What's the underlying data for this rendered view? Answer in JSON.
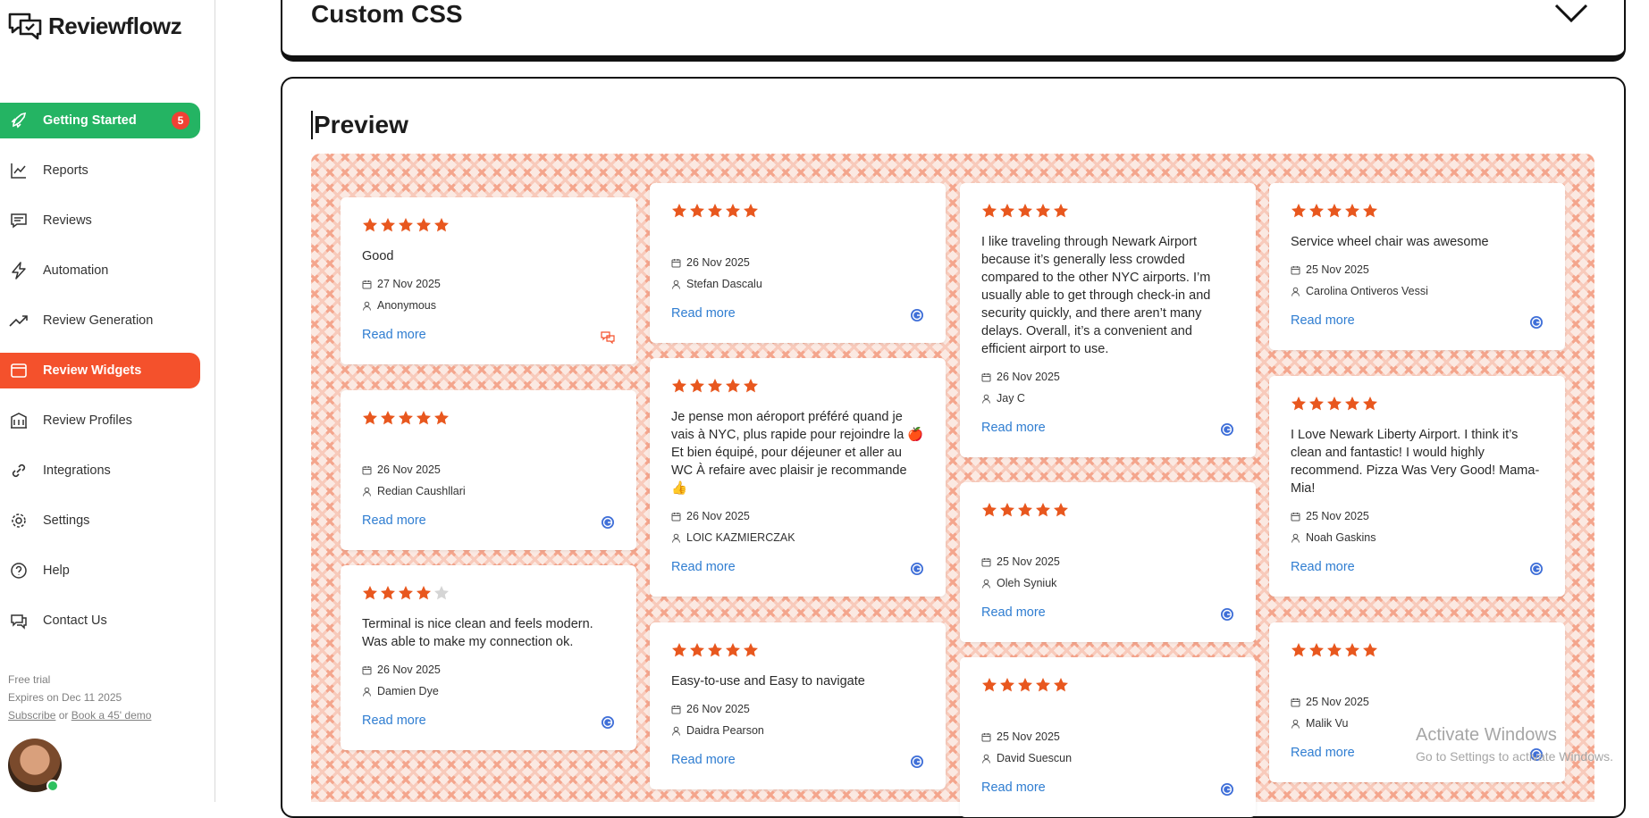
{
  "app": {
    "name": "Reviewflowz"
  },
  "sidebar": {
    "items": [
      {
        "label": "Getting Started",
        "icon": "rocket-icon",
        "badge": "5"
      },
      {
        "label": "Reports",
        "icon": "chart-icon"
      },
      {
        "label": "Reviews",
        "icon": "message-icon"
      },
      {
        "label": "Automation",
        "icon": "bolt-icon"
      },
      {
        "label": "Review Generation",
        "icon": "trend-icon"
      },
      {
        "label": "Review Widgets",
        "icon": "widget-icon"
      },
      {
        "label": "Review Profiles",
        "icon": "building-icon"
      },
      {
        "label": "Integrations",
        "icon": "link-icon"
      },
      {
        "label": "Settings",
        "icon": "gear-icon"
      },
      {
        "label": "Help",
        "icon": "help-icon"
      },
      {
        "label": "Contact Us",
        "icon": "chat-icon"
      }
    ],
    "trial": {
      "status": "Free trial",
      "expires": "Expires on Dec 11 2025",
      "subscribe": "Subscribe",
      "or": "or",
      "demo": "Book a 45' demo"
    }
  },
  "panels": {
    "custom_css_title": "Custom CSS",
    "preview_title": "Preview"
  },
  "colors": {
    "accent_green": "#24b463",
    "accent_red": "#f4512c",
    "star": "#e8571e",
    "link": "#2f7dd1"
  },
  "read_more": "Read more",
  "reviews": [
    {
      "stars": 5,
      "text": "Good",
      "date": "27 Nov 2025",
      "author": "Anonymous",
      "source": "chat-source-icon"
    },
    {
      "stars": 5,
      "text": "",
      "date": "26 Nov 2025",
      "author": "Redian Caushllari",
      "source": "google-source-icon"
    },
    {
      "stars": 4,
      "text": "Terminal is nice clean and feels modern. Was able to make my connection ok.",
      "date": "26 Nov 2025",
      "author": "Damien Dye",
      "source": "google-source-icon"
    },
    {
      "stars": 5,
      "text": "",
      "date": "26 Nov 2025",
      "author": "Stefan Dascalu",
      "source": "google-source-icon"
    },
    {
      "stars": 5,
      "text": "Je pense mon aéroport préféré quand je vais à NYC, plus rapide pour rejoindre la 🍎 Et bien équipé, pour déjeuner et aller au WC À refaire avec plaisir je recommande 👍",
      "date": "26 Nov 2025",
      "author": "LOIC KAZMIERCZAK",
      "source": "google-source-icon"
    },
    {
      "stars": 5,
      "text": "Easy-to-use and Easy to navigate",
      "date": "26 Nov 2025",
      "author": "Daidra Pearson",
      "source": "google-source-icon"
    },
    {
      "stars": 5,
      "text": "I like traveling through Newark Airport because it’s generally less crowded compared to the other NYC airports. I’m usually able to get through check-in and security quickly, and there aren’t many delays. Overall, it’s a convenient and efficient airport to use.",
      "date": "26 Nov 2025",
      "author": "Jay C",
      "source": "google-source-icon"
    },
    {
      "stars": 5,
      "text": "",
      "date": "25 Nov 2025",
      "author": "Oleh Syniuk",
      "source": "google-source-icon"
    },
    {
      "stars": 5,
      "text": "",
      "date": "25 Nov 2025",
      "author": "David Suescun",
      "source": "google-source-icon"
    },
    {
      "stars": 5,
      "text": "Service wheel chair was awesome",
      "date": "25 Nov 2025",
      "author": "Carolina Ontiveros Vessi",
      "source": "google-source-icon"
    },
    {
      "stars": 5,
      "text": "I Love Newark Liberty Airport. I think it’s clean and fantastic! I would highly recommend. Pizza Was Very Good! Mama-Mia!",
      "date": "25 Nov 2025",
      "author": "Noah Gaskins",
      "source": "google-source-icon"
    },
    {
      "stars": 5,
      "text": "",
      "date": "25 Nov 2025",
      "author": "Malik Vu",
      "source": "google-source-icon"
    }
  ],
  "watermark": {
    "line1": "Activate Windows",
    "line2": "Go to Settings to activate Windows."
  }
}
